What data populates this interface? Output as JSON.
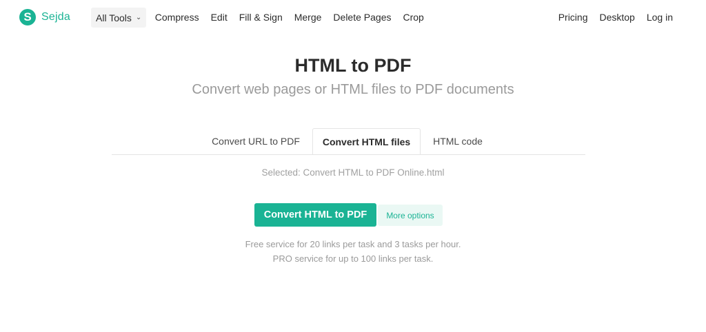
{
  "brand": {
    "name": "Sejda",
    "logo_letter": "S",
    "accent": "#1ab394"
  },
  "nav": {
    "all_tools": "All Tools",
    "items": [
      "Compress",
      "Edit",
      "Fill & Sign",
      "Merge",
      "Delete Pages",
      "Crop"
    ],
    "right": [
      "Pricing",
      "Desktop",
      "Log in"
    ]
  },
  "hero": {
    "title": "HTML to PDF",
    "subtitle": "Convert web pages or HTML files to PDF documents"
  },
  "tabs": [
    {
      "label": "Convert URL to PDF",
      "active": false
    },
    {
      "label": "Convert HTML files",
      "active": true
    },
    {
      "label": "HTML code",
      "active": false
    }
  ],
  "selected_text": "Selected: Convert HTML to PDF Online.html",
  "actions": {
    "convert": "Convert HTML to PDF",
    "more_options": "More options"
  },
  "info": {
    "line1": "Free service for 20 links per task and 3 tasks per hour.",
    "line2": "PRO service for up to 100 links per task."
  }
}
